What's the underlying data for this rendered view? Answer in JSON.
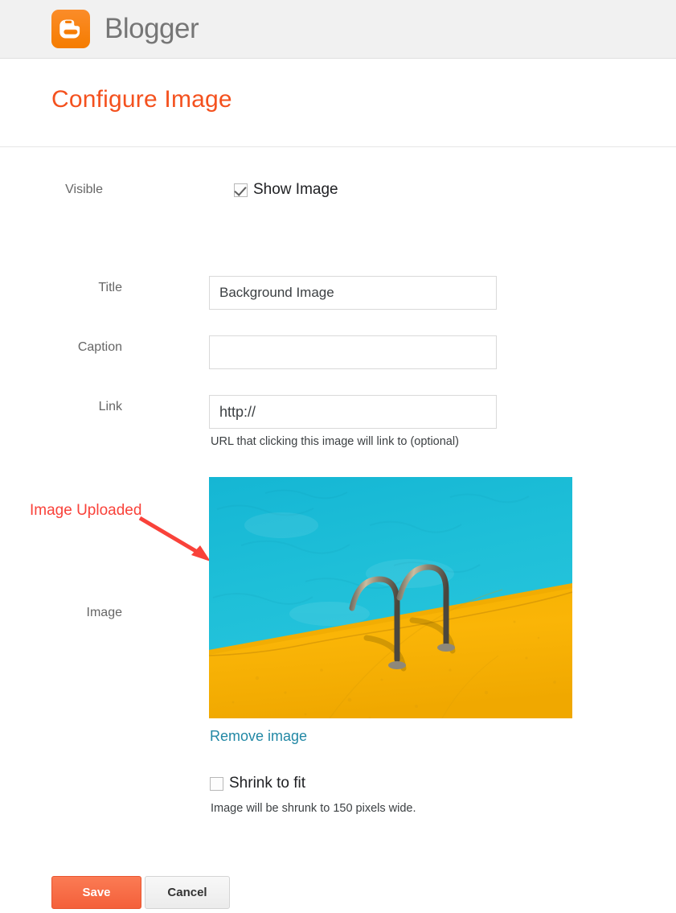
{
  "header": {
    "brand_name": "Blogger",
    "logo_icon": "blogger-b-icon",
    "logo_color": "#f57c00"
  },
  "page": {
    "title": "Configure Image",
    "title_color": "#f4511e"
  },
  "form": {
    "visible": {
      "label": "Visible",
      "checkbox_label": "Show Image",
      "checked": true
    },
    "title": {
      "label": "Title",
      "value": "Background Image",
      "placeholder": ""
    },
    "caption": {
      "label": "Caption",
      "value": "",
      "placeholder": ""
    },
    "link": {
      "label": "Link",
      "value": "http://",
      "placeholder": "http://",
      "help": "URL that clicking this image will link to (optional)"
    },
    "image": {
      "label": "Image",
      "remove_link": "Remove image",
      "alt": "Swimming pool with turquoise water and yellow deck with two metal ladder handrails"
    },
    "shrink": {
      "checkbox_label": "Shrink to fit",
      "checked": false,
      "help": "Image will be shrunk to 150 pixels wide."
    }
  },
  "annotation": {
    "text": "Image Uploaded",
    "color": "#f9423a",
    "arrow_icon": "arrow-down-right-icon"
  },
  "actions": {
    "save_label": "Save",
    "save_color": "#f4603a",
    "cancel_label": "Cancel"
  }
}
